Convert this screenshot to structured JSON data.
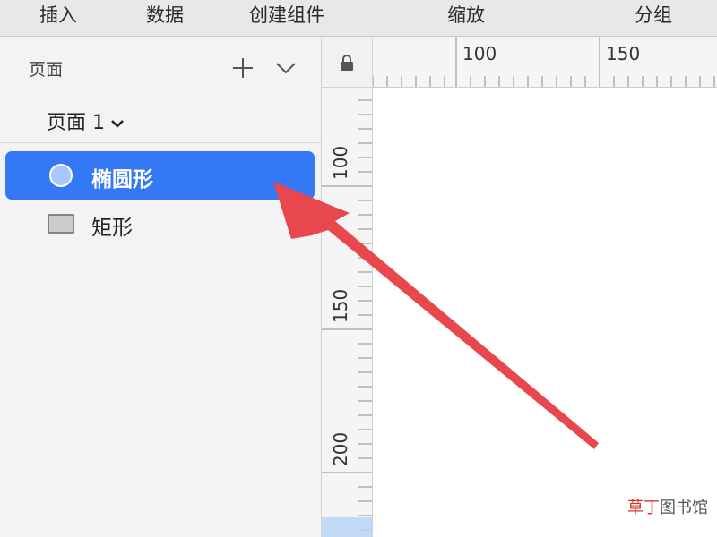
{
  "toolbar": {
    "items": [
      "插入",
      "数据",
      "创建组件",
      "缩放",
      "分组"
    ]
  },
  "sidebar": {
    "title": "页面",
    "current_page": "页面 1",
    "layers": [
      {
        "label": "椭圆形",
        "icon": "ellipse-icon",
        "selected": true
      },
      {
        "label": "矩形",
        "icon": "rectangle-icon",
        "selected": false
      }
    ]
  },
  "ruler": {
    "top_labels": [
      "100",
      "150"
    ],
    "left_labels": [
      "100",
      "150",
      "200"
    ]
  },
  "watermark": {
    "accent": "草丁",
    "rest": "图书馆"
  },
  "colors": {
    "accent": "#3478f6",
    "arrow": "#e8484d"
  }
}
